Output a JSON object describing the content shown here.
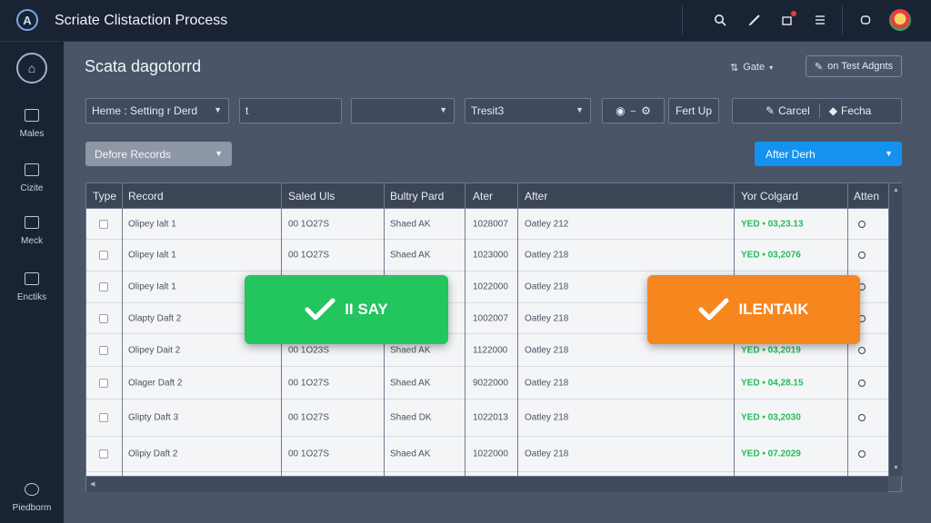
{
  "app": {
    "title": "Scriate Clistaction Process"
  },
  "topbar": {
    "icons": [
      "search-icon",
      "pen-icon",
      "notification-icon",
      "menu-icon",
      "chat-icon"
    ]
  },
  "sidebar": {
    "items": [
      {
        "label": "Males",
        "icon": "box-icon"
      },
      {
        "label": "Cizite",
        "icon": "grid-icon"
      },
      {
        "label": "Meck",
        "icon": "building-icon"
      },
      {
        "label": "Enctiks",
        "icon": "document-icon"
      },
      {
        "label": "Piedborm",
        "icon": "platform-icon"
      }
    ]
  },
  "panel": {
    "title": "Scata dagotorrd",
    "action_label": "Gate",
    "action_btn_label": "on Test Adgnts"
  },
  "filters": {
    "f1": "Heme : Setting r Derd",
    "f2": "t",
    "f3": "",
    "f4": "Tresit3",
    "fert_up": "Fert Up",
    "cancel": "Carcel",
    "fecha": "Fecha"
  },
  "selectors": {
    "before": "Defore Records",
    "after": "After Derh"
  },
  "table": {
    "headers": [
      "Type",
      "Record",
      "Saled Uls",
      "Bultry Pard",
      "Ater",
      "After",
      "Yor Colgard",
      "Atten"
    ],
    "rows": [
      {
        "record": "Olipey Ialt 1",
        "saled": "00 1O27S",
        "bultry": "Shaed AK",
        "ater": "1028007",
        "after": "Oatley 212",
        "yor": "YED • 03,23.13"
      },
      {
        "record": "Olipey Ialt 1",
        "saled": "00 1O27S",
        "bultry": "Shaed AK",
        "ater": "1023000",
        "after": "Oatley 218",
        "yor": "YED • 03,2076"
      },
      {
        "record": "Olipey Ialt 1",
        "saled": "",
        "bultry": "",
        "ater": "1022000",
        "after": "Oatley 218",
        "yor": ""
      },
      {
        "record": "Olapty Daft 2",
        "saled": "",
        "bultry": "",
        "ater": "1002007",
        "after": "Oatley 218",
        "yor": ""
      },
      {
        "record": "Olipey Dait 2",
        "saled": "00 1O23S",
        "bultry": "Shaed AK",
        "ater": "1122000",
        "after": "Oatley 218",
        "yor": "YED • 03,2019"
      },
      {
        "record": "Olager Daft 2",
        "saled": "00 1O27S",
        "bultry": "Shaed AK",
        "ater": "9022000",
        "after": "Oatley 218",
        "yor": "YED • 04,28.15"
      },
      {
        "record": "Glipty Daft 3",
        "saled": "00 1O27S",
        "bultry": "Shaed DK",
        "ater": "1022013",
        "after": "Oatley 218",
        "yor": "YED • 03,2030"
      },
      {
        "record": "Olipiy Daft 2",
        "saled": "00 1O27S",
        "bultry": "Shaed AK",
        "ater": "1022000",
        "after": "Oatley 218",
        "yor": "YED • 07.2029"
      }
    ]
  },
  "overlays": {
    "left": "II SAY",
    "right": "ILENTAIK"
  },
  "colors": {
    "accent_blue": "#1592f0",
    "success_green": "#22c55e",
    "warning_orange": "#f6871f",
    "status_text_green": "#1fbf5a"
  }
}
